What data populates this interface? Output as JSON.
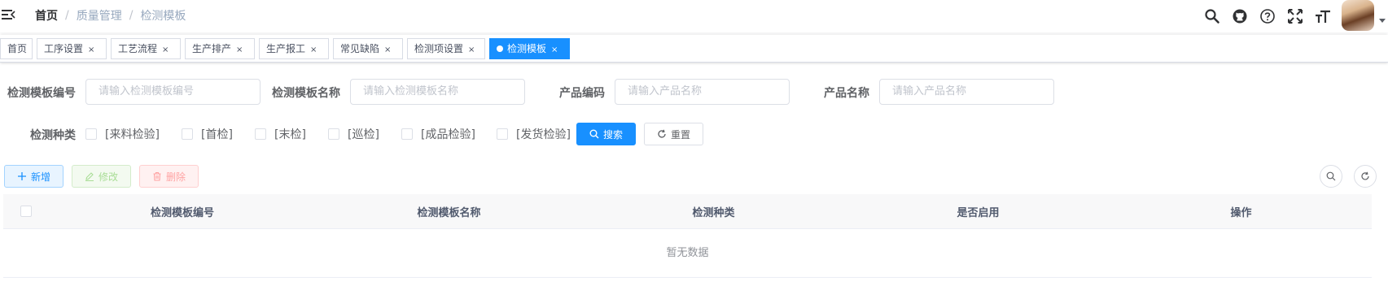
{
  "breadcrumb": {
    "home": "首页",
    "separator": "/",
    "parent": "质量管理",
    "current": "检测模板"
  },
  "header_icons": [
    "search-icon",
    "github-icon",
    "help-icon",
    "fullscreen-icon",
    "font-size-icon"
  ],
  "tags": [
    {
      "label": "首页",
      "closable": false,
      "active": false
    },
    {
      "label": "工序设置",
      "closable": true,
      "active": false
    },
    {
      "label": "工艺流程",
      "closable": true,
      "active": false
    },
    {
      "label": "生产排产",
      "closable": true,
      "active": false
    },
    {
      "label": "生产报工",
      "closable": true,
      "active": false
    },
    {
      "label": "常见缺陷",
      "closable": true,
      "active": false
    },
    {
      "label": "检测项设置",
      "closable": true,
      "active": false
    },
    {
      "label": "检测模板",
      "closable": true,
      "active": true
    }
  ],
  "tag_close_glyph": "×",
  "search_form": {
    "template_code_label": "检测模板编号",
    "template_code_placeholder": "请输入检测模板编号",
    "template_name_label": "检测模板名称",
    "template_name_placeholder": "请输入检测模板名称",
    "product_code_label": "产品编码",
    "product_code_placeholder": "请输入产品名称",
    "product_name_label": "产品名称",
    "product_name_placeholder": "请输入产品名称",
    "test_type_label": "检测种类",
    "test_types": [
      "[来料检验]",
      "[首检]",
      "[末检]",
      "[巡检]",
      "[成品检验]",
      "[发货检验]"
    ],
    "search_button": "搜索",
    "reset_button": "重置"
  },
  "toolbar": {
    "add": "新增",
    "edit": "修改",
    "delete": "删除"
  },
  "table": {
    "columns": [
      "检测模板编号",
      "检测模板名称",
      "检测种类",
      "是否启用",
      "操作"
    ],
    "empty_text": "暂无数据"
  },
  "colors": {
    "primary": "#1890ff",
    "success": "#13ce66",
    "danger": "#ff4949"
  }
}
